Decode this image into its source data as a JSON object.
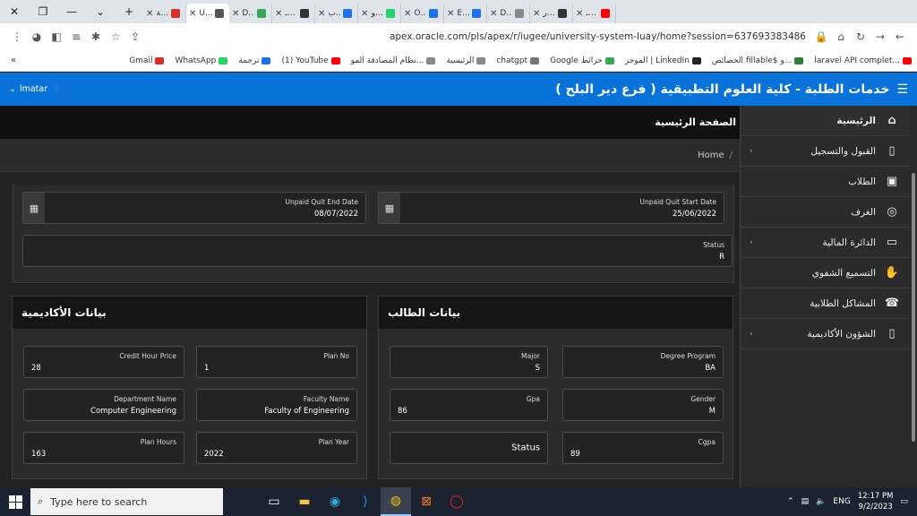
{
  "browser": {
    "tabs": [
      {
        "label": "علامة",
        "active": false,
        "color": "#d93025"
      },
      {
        "label": "Univer",
        "active": true,
        "color": "#555555"
      },
      {
        "label": "DB-for",
        "active": false,
        "color": "#34a853"
      },
      {
        "label": "لؤي مـ",
        "active": false,
        "color": "#333333"
      },
      {
        "label": "واتساب",
        "active": false,
        "color": "#1a73e8"
      },
      {
        "label": "اوقتو:",
        "active": false,
        "color": "#25d366"
      },
      {
        "label": "OFFTO",
        "active": false,
        "color": "#1a73e8"
      },
      {
        "label": "Elimin",
        "active": false,
        "color": "#1a73e8"
      },
      {
        "label": "Docun",
        "active": false,
        "color": "#888888"
      },
      {
        "label": "مهرجار",
        "active": false,
        "color": "#333333"
      },
      {
        "label": "لؤي مـ",
        "active": false,
        "color": "#ff0000"
      }
    ],
    "url": "apex.oracle.com/pls/apex/r/iugee/university-system-luay/home?session=637693383486",
    "bookmarks": [
      {
        "label": "Gmail",
        "color": "#d93025"
      },
      {
        "label": "WhatsApp",
        "color": "#25d366"
      },
      {
        "label": "ترجمة",
        "color": "#1a73e8"
      },
      {
        "label": "(1) YouTube",
        "color": "#ff0000"
      },
      {
        "label": "نظام المصادقة المو...",
        "color": "#888888"
      },
      {
        "label": "الرئيسية",
        "color": "#888888"
      },
      {
        "label": "chatgpt",
        "color": "#777777"
      },
      {
        "label": "Google خرائط",
        "color": "#34a853"
      },
      {
        "label": "الموجز | LinkedIn",
        "color": "#222222"
      },
      {
        "label": "الخصائص fillable$ و...",
        "color": "#2e7d32"
      },
      {
        "label": "laravel API complet...",
        "color": "#ff0000"
      }
    ]
  },
  "header": {
    "title": "خدمات الطلبة - كلية العلوم التطبيقية ( فرع دير البلح )",
    "user": "lmatar"
  },
  "sidebar": {
    "items": [
      {
        "label": "الرئيسية",
        "icon": "⌂",
        "has_children": false,
        "active": true
      },
      {
        "label": "القبول والتسجيل",
        "icon": "▯",
        "has_children": true,
        "active": false
      },
      {
        "label": "الطلاب",
        "icon": "▣",
        "has_children": false,
        "active": false
      },
      {
        "label": "الغرف",
        "icon": "◎",
        "has_children": false,
        "active": false
      },
      {
        "label": "الدائرة المالية",
        "icon": "▭",
        "has_children": true,
        "active": false
      },
      {
        "label": "التسميع الشفوي",
        "icon": "✋",
        "has_children": false,
        "active": false
      },
      {
        "label": "المشاكل الطلابية",
        "icon": "☎",
        "has_children": false,
        "active": false
      },
      {
        "label": "الشؤون الأكاديمية",
        "icon": "▯",
        "has_children": true,
        "active": false
      }
    ]
  },
  "page": {
    "title": "الصفحة الرئيسية",
    "breadcrumb": "Home"
  },
  "top_fields": {
    "unpaid_quit_start_label": "Unpaid Quit Start Date",
    "unpaid_quit_start_value": "25/06/2022",
    "unpaid_quit_end_label": "Unpaid Quit End Date",
    "unpaid_quit_end_value": "08/07/2022",
    "status_label": "Status",
    "status_value": "R"
  },
  "student_region": {
    "title": "بيانات الطالب",
    "degree_program_label": "Degree Program",
    "degree_program_value": "BA",
    "major_label": "Major",
    "major_value": "S",
    "gender_label": "Gender",
    "gender_value": "M",
    "gpa_label": "Gpa",
    "gpa_value": "86",
    "cgpa_label": "Cgpa",
    "cgpa_value": "89",
    "status_label": "Status"
  },
  "academic_region": {
    "title": "بيانات الأكاديمية",
    "plan_no_label": "Plan No",
    "plan_no_value": "1",
    "credit_hour_price_label": "Credit Hour Price",
    "credit_hour_price_value": "28",
    "faculty_name_label": "Faculty Name",
    "faculty_name_value": "Faculty of Engineering",
    "department_name_label": "Department Name",
    "department_name_value": "Computer Engineering",
    "plan_year_label": "Plan Year",
    "plan_year_value": "2022",
    "plan_hours_label": "Plan Hours",
    "plan_hours_value": "163"
  },
  "taskbar": {
    "search_placeholder": "Type here to search",
    "language": "ENG",
    "time": "12:17 PM",
    "date": "9/2/2023"
  }
}
